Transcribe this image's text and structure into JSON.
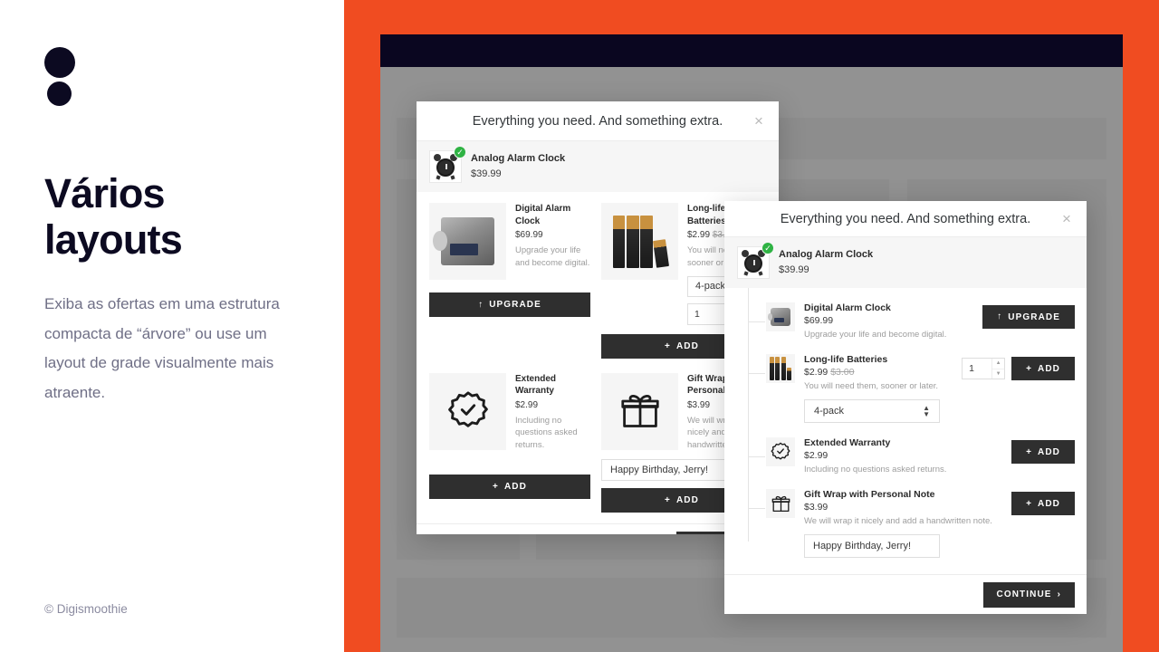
{
  "left_panel": {
    "logo_name": "digismoothie-logo",
    "headline": "Vários\nlayouts",
    "headline_line1": "Vários",
    "headline_line2": "layouts",
    "subcopy": "Exiba as ofertas em uma estrutura compacta de “árvore” ou use um layout de grade visualmente mais atraente.",
    "copyright": "© Digismoothie"
  },
  "colors": {
    "brand_orange": "#f04c21",
    "ink": "#0c0a21",
    "body_text": "#6f6f86",
    "page_gray": "#929292",
    "topbar": "#0a0620",
    "button_dark": "#2f2f2f",
    "check_green": "#2fb344"
  },
  "modal": {
    "title": "Everything you need. And something extra.",
    "close_label": "×",
    "continue_label": "CONTINUE",
    "continue_chevron": "›"
  },
  "parent_product": {
    "name": "Analog Alarm Clock",
    "price": "$39.99",
    "thumb_icon": "analog-alarm-clock-image",
    "selected_badge": "✓"
  },
  "offers": [
    {
      "id": "digital-alarm-clock",
      "name": "Digital Alarm Clock",
      "price": "$69.99",
      "compare_price": "",
      "description": "Upgrade your life and become digital.",
      "description_grid": "Upgrade your life and become digital.",
      "button_label": "UPGRADE",
      "button_icon": "↑",
      "has_quantity": false,
      "has_variant_select": false,
      "has_note_input": false,
      "image": "digital-alarm-clock-image"
    },
    {
      "id": "long-life-batteries",
      "name": "Long-life Batteries",
      "price": "$2.99",
      "compare_price": "$3.00",
      "description": "You will need them, sooner or later.",
      "description_grid": "You will need them, sooner or later.",
      "button_label": "ADD",
      "button_icon": "+",
      "has_quantity": true,
      "quantity_value": "1",
      "has_variant_select": true,
      "variant_value": "4-pack",
      "has_note_input": false,
      "image": "batteries-image"
    },
    {
      "id": "extended-warranty",
      "name": "Extended Warranty",
      "price": "$2.99",
      "compare_price": "",
      "description": "Including no questions asked returns.",
      "description_grid": "Including no questions asked returns.",
      "button_label": "ADD",
      "button_icon": "+",
      "has_quantity": false,
      "has_variant_select": false,
      "has_note_input": false,
      "image": "warranty-badge-icon"
    },
    {
      "id": "gift-wrap-with-personal-note",
      "name": "Gift Wrap with Personal Note",
      "price": "$3.99",
      "compare_price": "",
      "description": "We will wrap it nicely and add a handwritten note.",
      "description_grid": "We will wrap it nicely and add a handwritten note.",
      "button_label": "ADD",
      "button_icon": "+",
      "has_quantity": false,
      "has_variant_select": false,
      "has_note_input": true,
      "note_value": "Happy Birthday, Jerry!",
      "image": "gift-box-icon"
    }
  ]
}
